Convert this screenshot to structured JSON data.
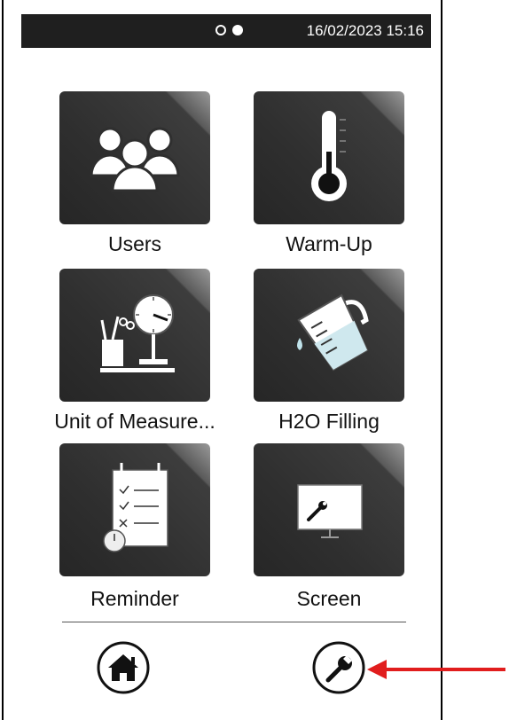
{
  "statusbar": {
    "datetime": "16/02/2023 15:16"
  },
  "tiles": [
    {
      "label": "Users",
      "icon": "users-icon"
    },
    {
      "label": "Warm-Up",
      "icon": "thermometer-icon"
    },
    {
      "label": "Unit of Measure...",
      "icon": "scale-icon"
    },
    {
      "label": "H2O Filling",
      "icon": "water-jug-icon"
    },
    {
      "label": "Reminder",
      "icon": "checklist-icon"
    },
    {
      "label": "Screen",
      "icon": "screen-wrench-icon"
    }
  ],
  "nav": {
    "home_icon": "home-icon",
    "settings_icon": "wrench-icon"
  },
  "colors": {
    "statusbar": "#1f1f1f",
    "tile": "#2f2f2f",
    "arrow": "#e11d1d"
  }
}
